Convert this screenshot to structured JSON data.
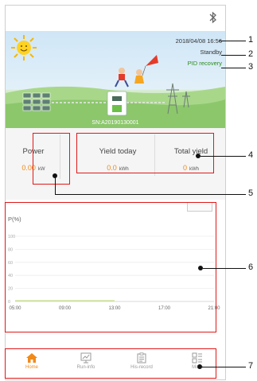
{
  "status": {
    "datetime": "2018/04/08 16:56",
    "state": "Standby",
    "pid": "PID recovery",
    "serial": "SN:A20190130001"
  },
  "power": {
    "label": "Power",
    "value": "0.00",
    "unit": "kW"
  },
  "yield_today": {
    "label": "Yield today",
    "value": "0.0",
    "unit": "kWh"
  },
  "total_yield": {
    "label": "Total yield",
    "value": "0",
    "unit": "kWh"
  },
  "chart_data": {
    "type": "line",
    "ylabel": "P(%)",
    "x": [
      "05:00",
      "09:00",
      "13:00",
      "17:00",
      "21:00"
    ],
    "yticks": [
      "100",
      "80",
      "60",
      "40",
      "20",
      "0"
    ],
    "ylim": [
      0,
      100
    ],
    "series": [
      {
        "values": [
          0,
          0,
          0,
          0,
          0
        ]
      }
    ],
    "grid": true
  },
  "nav": [
    {
      "label": "Home",
      "icon": "home-icon",
      "active": true
    },
    {
      "label": "Run-info",
      "icon": "run-info-icon",
      "active": false
    },
    {
      "label": "His-record",
      "icon": "his-record-icon",
      "active": false
    },
    {
      "label": "More",
      "icon": "more-icon",
      "active": false
    }
  ],
  "callouts": [
    "1",
    "2",
    "3",
    "4",
    "5",
    "6",
    "7"
  ],
  "colors": {
    "accent": "#f08a1a",
    "callout_box": "#e01818",
    "status_green": "#2e8b1e"
  }
}
